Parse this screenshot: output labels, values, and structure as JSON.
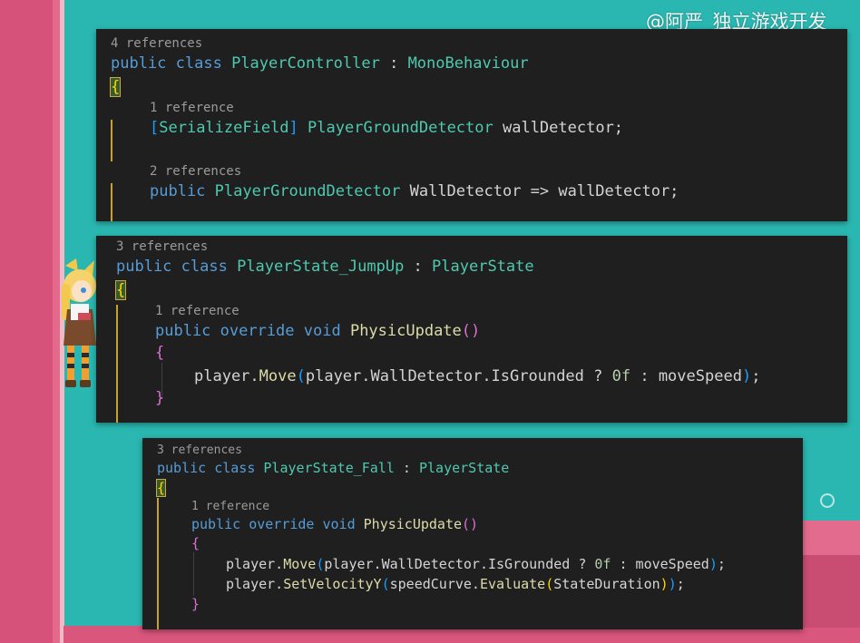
{
  "watermark": "@阿严_独立游戏开发",
  "panel1": {
    "ref_class": "4 references",
    "class_kw": "public class",
    "class_name": "PlayerController",
    "colon": " : ",
    "base_class": "MonoBehaviour",
    "open_brace": "{",
    "ref_field": "1 reference",
    "attr_open": "[",
    "attr_name": "SerializeField",
    "attr_close": "]",
    "field_type": "PlayerGroundDetector",
    "field_name": " wallDetector;",
    "ref_prop": "2 references",
    "prop_kw": "public",
    "prop_type": "PlayerGroundDetector",
    "prop_name": " WallDetector => wallDetector;"
  },
  "panel2": {
    "ref_class": "3 references",
    "class_kw": "public class",
    "class_name": "PlayerState_JumpUp",
    "colon": " : ",
    "base_class": "PlayerState",
    "open_brace": "{",
    "ref_method": "1 reference",
    "method_kw": "public override void",
    "method_name": "PhysicUpdate",
    "method_parens": "()",
    "body_open": "{",
    "body_close": "}",
    "stmt_obj": "player.",
    "stmt_fn": "Move",
    "stmt_open": "(",
    "stmt_args": "player.WallDetector.IsGrounded ? ",
    "stmt_num": "0f",
    "stmt_rest": " : moveSpeed",
    "stmt_close": ")",
    "stmt_end": ";"
  },
  "panel3": {
    "ref_class": "3 references",
    "class_kw": "public class",
    "class_name": "PlayerState_Fall",
    "colon": " : ",
    "base_class": "PlayerState",
    "open_brace": "{",
    "ref_method": "1 reference",
    "method_kw": "public override void",
    "method_name": "PhysicUpdate",
    "method_parens": "()",
    "body_open": "{",
    "body_close": "}",
    "stmt1_obj": "player.",
    "stmt1_fn": "Move",
    "stmt1_open": "(",
    "stmt1_args": "player.WallDetector.IsGrounded ? ",
    "stmt1_num": "0f",
    "stmt1_rest": " : moveSpeed",
    "stmt1_close": ")",
    "stmt1_end": ";",
    "stmt2_obj": "player.",
    "stmt2_fn": "SetVelocityY",
    "stmt2_open": "(",
    "stmt2_a": "speedCurve.",
    "stmt2_fn2": "Evaluate",
    "stmt2_open2": "(",
    "stmt2_arg": "StateDuration",
    "stmt2_close2": ")",
    "stmt2_close": ")",
    "stmt2_end": ";"
  }
}
